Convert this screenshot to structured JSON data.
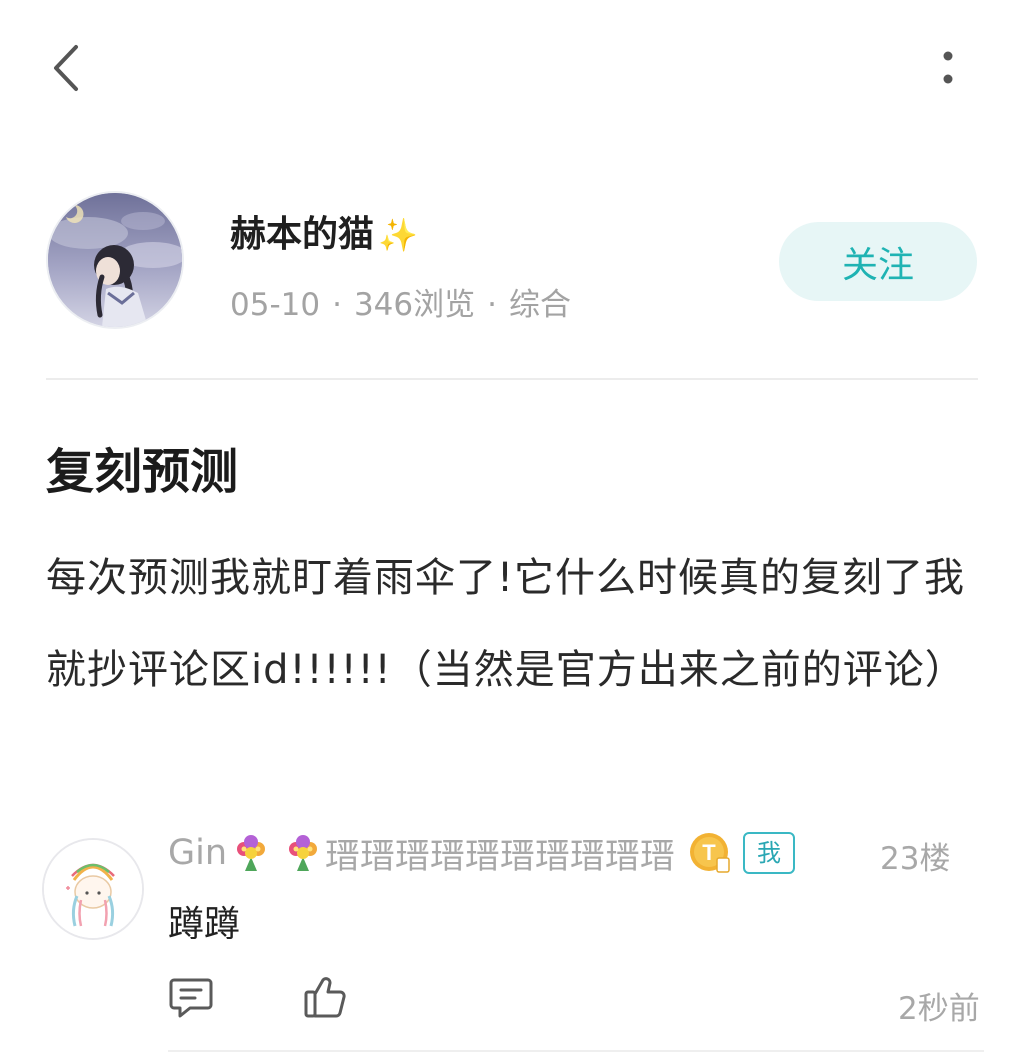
{
  "topbar": {
    "back_icon": "chevron-left-icon",
    "more_icon": "more-vertical-icon"
  },
  "author": {
    "name": "赫本的猫",
    "sparkle": "✨",
    "date": "05-10",
    "views": "346浏览",
    "category": "综合",
    "dot": "·",
    "follow_label": "关注"
  },
  "post": {
    "title": "复刻预测",
    "body": "每次预测我就盯着雨伞了!它什么时候真的复刻了我就抄评论区id!!!!!!（当然是官方出来之前的评论）"
  },
  "comment": {
    "username": "Gin",
    "username_suffix": "瑨瑨瑨瑨瑨瑨瑨瑨瑨瑨",
    "me_badge": "我",
    "level_badge_letter": "T",
    "floor": "23楼",
    "text": "蹲蹲",
    "time": "2秒前",
    "reply_icon": "comment-icon",
    "like_icon": "thumbs-up-icon"
  },
  "colors": {
    "accent": "#1fb3b3",
    "follow_bg": "#e7f6f6",
    "muted_text": "#a8a8a8"
  }
}
